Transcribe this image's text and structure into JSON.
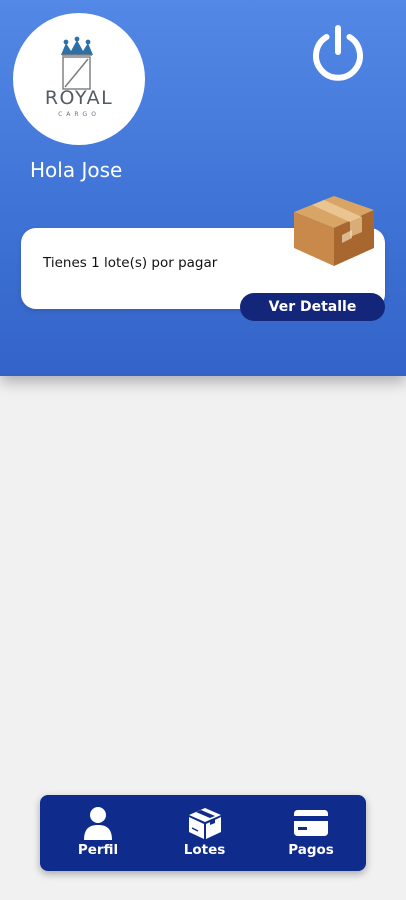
{
  "logo": {
    "brand": "ROYAL",
    "sub": "CARGO"
  },
  "header": {
    "greeting": "Hola Jose"
  },
  "card": {
    "message": "Tienes 1 lote(s) por pagar",
    "button_label": "Ver Detalle"
  },
  "nav": {
    "items": [
      {
        "label": "Perfil",
        "icon": "person-icon"
      },
      {
        "label": "Lotes",
        "icon": "box-icon"
      },
      {
        "label": "Pagos",
        "icon": "credit-card-icon"
      }
    ]
  },
  "colors": {
    "header_gradient_top": "#5388e6",
    "header_gradient_bottom": "#3463c8",
    "nav_background": "#0f2b8c",
    "button_background": "#13267a",
    "page_background": "#f1f1f1"
  }
}
